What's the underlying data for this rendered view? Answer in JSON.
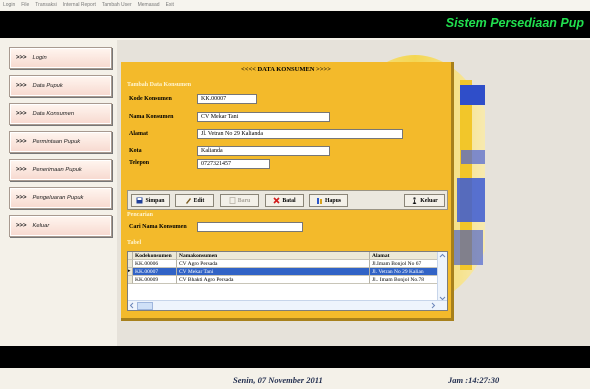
{
  "menubar": {
    "items": [
      "Login",
      "File",
      "Transaksi",
      "Internal Report",
      "Tambah User",
      "Memasad",
      "Exit"
    ]
  },
  "header": {
    "title": "Sistem Persediaan Pup"
  },
  "sidebar": {
    "items": [
      {
        "arrow": ">>>",
        "label": "Login"
      },
      {
        "arrow": ">>>",
        "label": "Data Pupuk"
      },
      {
        "arrow": ">>>",
        "label": "Data Konsumen"
      },
      {
        "arrow": ">>>",
        "label": "Permintaan Pupuk"
      },
      {
        "arrow": ">>>",
        "label": "Penerimaan Pupuk"
      },
      {
        "arrow": ">>>",
        "label": "Pengeluaran Pupuk"
      },
      {
        "arrow": ">>>",
        "label": "Keluar"
      }
    ]
  },
  "form": {
    "caption": "<<<< DATA KONSUMEN >>>>",
    "section_tambah": "Tambah Data Konsumen",
    "fields": {
      "kode": {
        "label": "Kode Konsumen",
        "value": "KK.00007"
      },
      "nama": {
        "label": "Nama Konsumen",
        "value": "CV Mekar Tani"
      },
      "alamat": {
        "label": "Alamat",
        "value": "Jl. Vetran No 29 Kalianda"
      },
      "kota": {
        "label": "Kota",
        "value": "Kalianda"
      },
      "telepon": {
        "label": "Telepon",
        "value": "0727321457"
      }
    },
    "toolbar": {
      "simpan": "Simpan",
      "edit": "Edit",
      "baru": "Baru",
      "batal": "Batal",
      "hapus": "Hapus",
      "keluar": "Keluar"
    },
    "section_pencarian": "Pencarian",
    "search": {
      "label": "Cari Nama Konsumen",
      "value": ""
    },
    "section_tabel": "Tabel",
    "table": {
      "columns": [
        "Kodekonsumen",
        "Namakonsumen",
        "Alamat"
      ],
      "rows": [
        [
          "KK.00006",
          "CV Agro Persada",
          "Jl.Imam Bonjol No 67"
        ],
        [
          "KK.00007",
          "CV Mekar Tani",
          "Jl. Vetran No 29 Kalian"
        ],
        [
          "KK.00009",
          "CV Bhakti Agro Persada",
          "Jl.. Imam Bonjol No.78"
        ]
      ],
      "selected_row": 1
    }
  },
  "status": {
    "date": "Senin, 07 November 2011",
    "time": "Jam :14:27:30"
  }
}
